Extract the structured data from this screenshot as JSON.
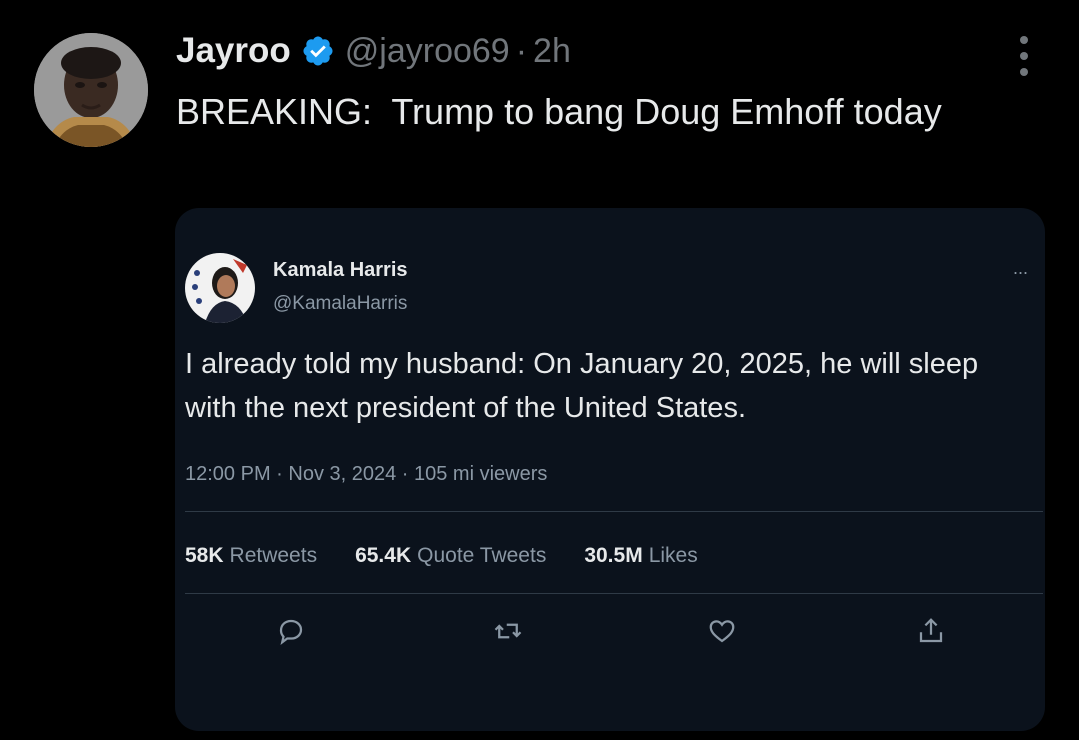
{
  "tweet": {
    "author_name": "Jayroo",
    "author_handle": "@jayroo69",
    "separator": "·",
    "time": "2h",
    "text": "BREAKING:  Trump to bang Doug Emhoff today"
  },
  "quoted": {
    "author_name": "Kamala Harris",
    "author_handle": "@KamalaHarris",
    "more_label": "...",
    "text": "I already told my husband: On January 20, 2025, he will sleep with the next president of the United States.",
    "meta": "12:00 PM · Nov 3, 2024 · 105 mi viewers",
    "stats": {
      "retweets_count": "58K",
      "retweets_label": "Retweets",
      "quotes_count": "65.4K",
      "quotes_label": "Quote Tweets",
      "likes_count": "30.5M",
      "likes_label": "Likes"
    },
    "actions": [
      "reply-icon",
      "retweet-icon",
      "like-icon",
      "share-icon"
    ]
  },
  "colors": {
    "background": "#000000",
    "text_primary": "#e7e9ea",
    "text_secondary": "#71767b",
    "verified_blue": "#1d9bf0",
    "card_background": "#0b121c"
  }
}
